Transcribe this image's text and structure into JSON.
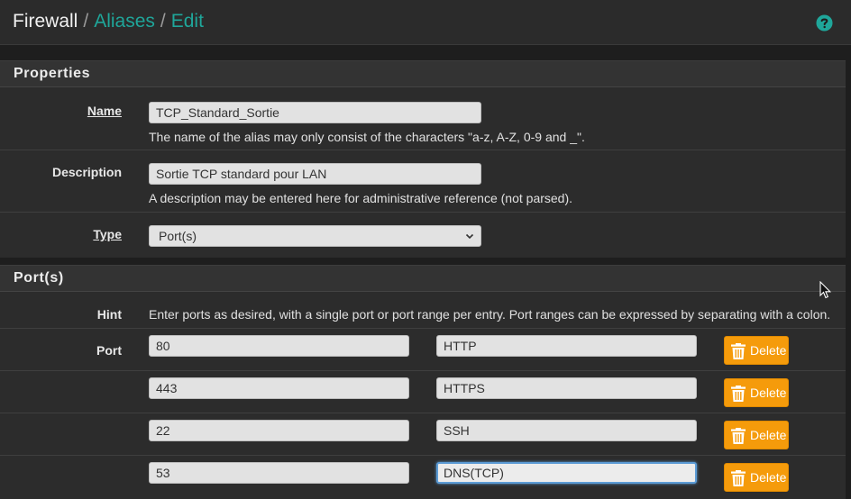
{
  "breadcrumb": {
    "home": "Firewall",
    "sep": "/",
    "aliases": "Aliases",
    "edit": "Edit"
  },
  "properties": {
    "title": "Properties",
    "name_label": "Name",
    "name_value": "TCP_Standard_Sortie",
    "name_help": "The name of the alias may only consist of the characters \"a-z, A-Z, 0-9 and _\".",
    "description_label": "Description",
    "description_value": "Sortie TCP standard pour LAN",
    "description_help": "A description may be entered here for administrative reference (not parsed).",
    "type_label": "Type",
    "type_value": "Port(s)"
  },
  "ports": {
    "title": "Port(s)",
    "hint_label": "Hint",
    "hint_text": "Enter ports as desired, with a single port or port range per entry. Port ranges can be expressed by separating with a colon.",
    "port_label": "Port",
    "delete_label": "Delete",
    "rows": [
      {
        "port": "80",
        "desc": "HTTP"
      },
      {
        "port": "443",
        "desc": "HTTPS"
      },
      {
        "port": "22",
        "desc": "SSH"
      },
      {
        "port": "53",
        "desc": "DNS(TCP)"
      }
    ]
  },
  "colors": {
    "accent": "#1fa69a",
    "delete": "#f59b0b",
    "background": "#1e1e1e"
  },
  "icons": {
    "help": "help-icon",
    "trash": "trash-icon",
    "chevron": "chevron-down-icon",
    "cursor": "mouse-cursor-icon"
  }
}
